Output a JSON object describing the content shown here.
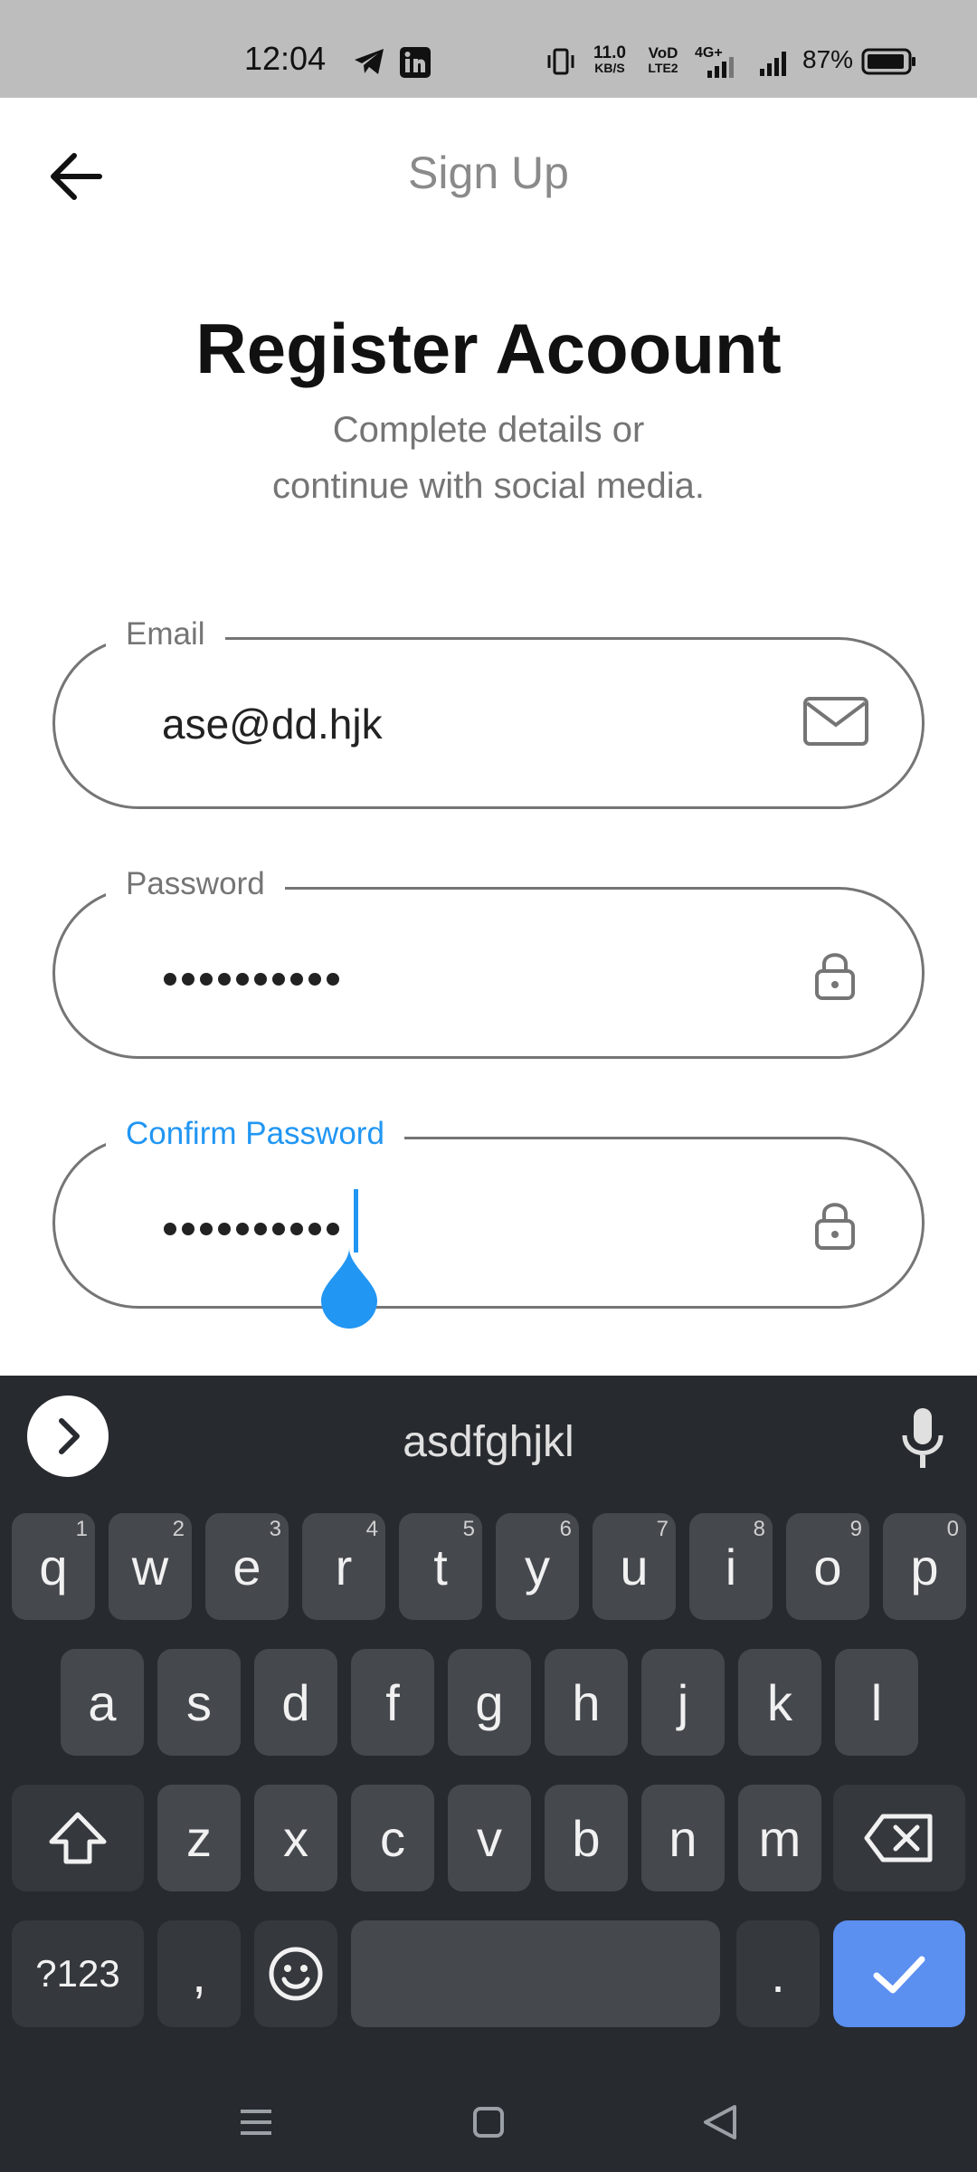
{
  "status_bar": {
    "time": "12:04",
    "net_speed_value": "11.0",
    "net_speed_unit": "KB/S",
    "volte_top": "VoD",
    "volte_bottom": "LTE2",
    "network_type": "4G+",
    "battery_percent": "87%",
    "icons": [
      "telegram-icon",
      "linkedin-icon",
      "vibrate-icon",
      "signal-icon",
      "battery-icon"
    ]
  },
  "app_bar": {
    "title": "Sign Up",
    "back_icon": "arrow-left-icon"
  },
  "header": {
    "headline": "Register Acoount",
    "subtext_line1": "Complete details or",
    "subtext_line2": "continue with social media."
  },
  "form": {
    "email": {
      "label": "Email",
      "value": "ase@dd.hjk",
      "icon": "mail-icon"
    },
    "password": {
      "label": "Password",
      "masked_length": 10,
      "icon": "lock-icon"
    },
    "confirm_password": {
      "label": "Confirm Password",
      "masked_length": 10,
      "icon": "lock-icon",
      "focused": true
    }
  },
  "keyboard": {
    "suggestion": "asdfghjkl",
    "row1": [
      {
        "key": "q",
        "hint": "1"
      },
      {
        "key": "w",
        "hint": "2"
      },
      {
        "key": "e",
        "hint": "3"
      },
      {
        "key": "r",
        "hint": "4"
      },
      {
        "key": "t",
        "hint": "5"
      },
      {
        "key": "y",
        "hint": "6"
      },
      {
        "key": "u",
        "hint": "7"
      },
      {
        "key": "i",
        "hint": "8"
      },
      {
        "key": "o",
        "hint": "9"
      },
      {
        "key": "p",
        "hint": "0"
      }
    ],
    "row2": [
      "a",
      "s",
      "d",
      "f",
      "g",
      "h",
      "j",
      "k",
      "l"
    ],
    "row3": [
      "z",
      "x",
      "c",
      "v",
      "b",
      "n",
      "m"
    ],
    "symbols_label": "?123",
    "comma_label": ",",
    "period_label": "."
  },
  "colors": {
    "accent": "#2196f3",
    "keyboard_bg": "#272a2f",
    "key_bg": "#45484d",
    "enter_key": "#5b8ff0",
    "status_bar_bg": "#bdbdbd"
  }
}
